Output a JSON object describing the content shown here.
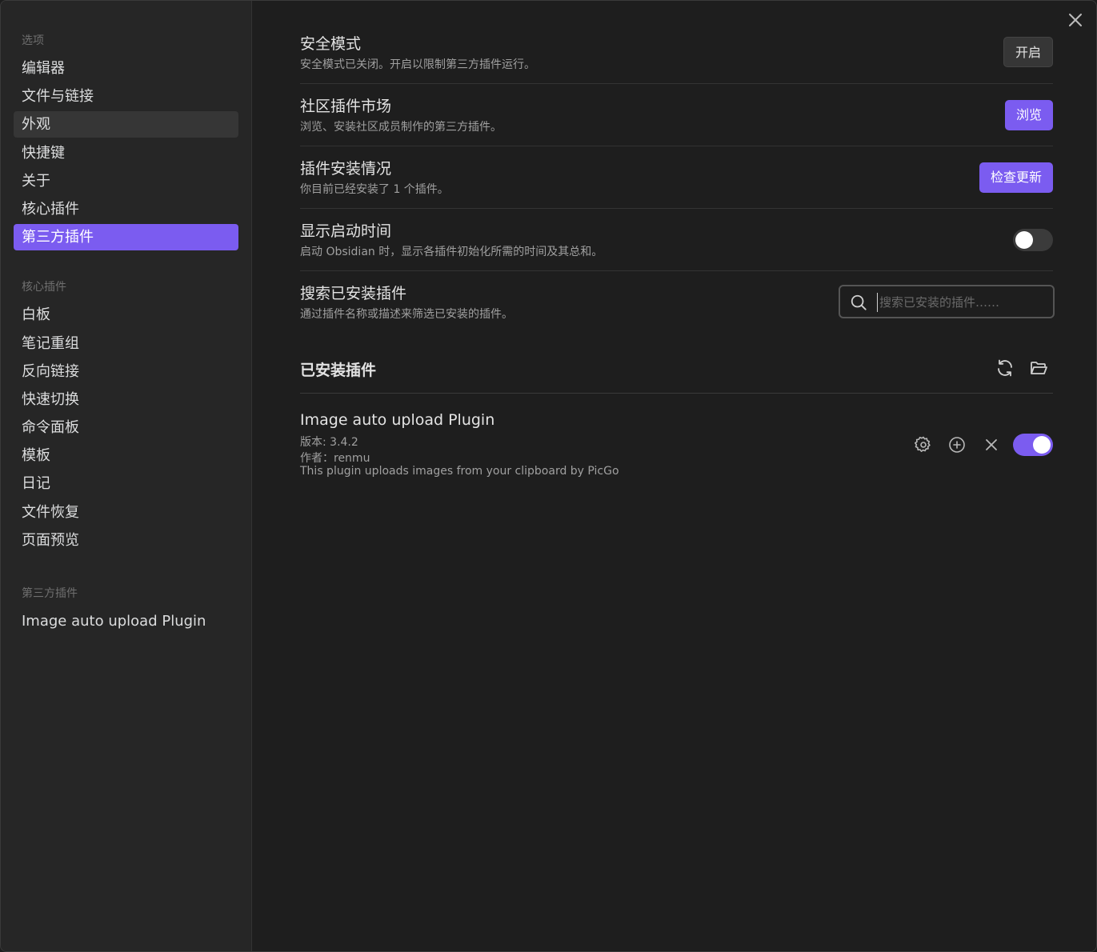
{
  "sidebar": {
    "group_options_title": "选项",
    "options_items": [
      {
        "label": "编辑器"
      },
      {
        "label": "文件与链接"
      },
      {
        "label": "外观"
      },
      {
        "label": "快捷键"
      },
      {
        "label": "关于"
      },
      {
        "label": "核心插件"
      },
      {
        "label": "第三方插件"
      }
    ],
    "group_core_title": "核心插件",
    "core_items": [
      {
        "label": "白板"
      },
      {
        "label": "笔记重组"
      },
      {
        "label": "反向链接"
      },
      {
        "label": "快速切换"
      },
      {
        "label": "命令面板"
      },
      {
        "label": "模板"
      },
      {
        "label": "日记"
      },
      {
        "label": "文件恢复"
      },
      {
        "label": "页面预览"
      }
    ],
    "group_community_title": "第三方插件",
    "community_items": [
      {
        "label": "Image auto upload Plugin"
      }
    ]
  },
  "settings": {
    "safe_mode": {
      "name": "安全模式",
      "desc": "安全模式已关闭。开启以限制第三方插件运行。",
      "button": "开启"
    },
    "marketplace": {
      "name": "社区插件市场",
      "desc": "浏览、安装社区成员制作的第三方插件。",
      "button": "浏览"
    },
    "install_status": {
      "name": "插件安装情况",
      "desc": "你目前已经安装了 1 个插件。",
      "button": "检查更新"
    },
    "startup_time": {
      "name": "显示启动时间",
      "desc": "启动 Obsidian 时，显示各插件初始化所需的时间及其总和。",
      "toggle_on": false
    },
    "search_installed": {
      "name": "搜索已安装插件",
      "desc": "通过插件名称或描述来筛选已安装的插件。",
      "placeholder": "搜索已安装的插件……"
    }
  },
  "installed": {
    "title": "已安装插件",
    "plugins": [
      {
        "name": "Image auto upload Plugin",
        "version": "版本: 3.4.2",
        "author": "作者：renmu",
        "description": "This plugin uploads images from your clipboard by PicGo",
        "enabled": true
      }
    ]
  },
  "colors": {
    "accent": "#7b5cf0",
    "background": "#1e1e1e",
    "sidebar": "#262626"
  }
}
